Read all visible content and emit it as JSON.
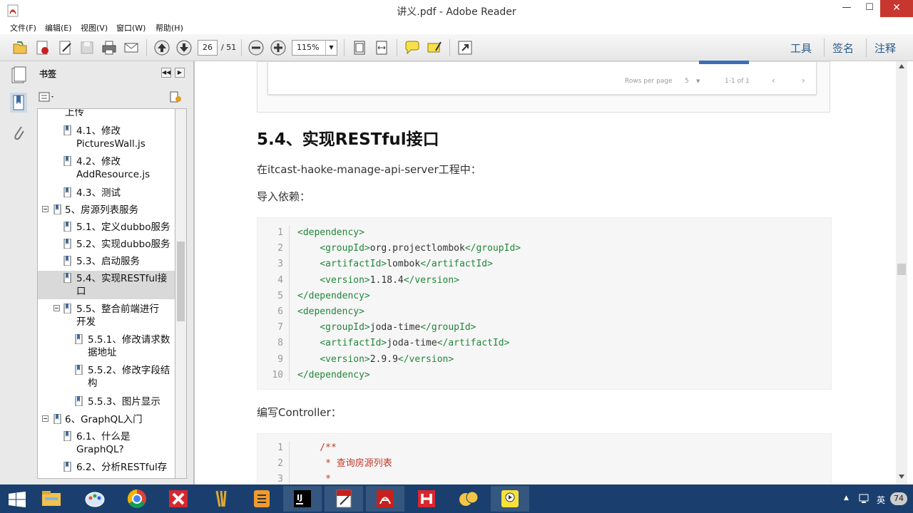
{
  "window": {
    "title": "讲义.pdf - Adobe Reader",
    "min_glyph": "—",
    "max_glyph": "☐",
    "close_glyph": "✕"
  },
  "menu": [
    "文件(F)",
    "编辑(E)",
    "视图(V)",
    "窗口(W)",
    "帮助(H)"
  ],
  "toolbar": {
    "page_current": "26",
    "page_total": "/ 51",
    "zoom": "115%",
    "zoom_arrow": "▼",
    "right_links": [
      "工具",
      "签名",
      "注释"
    ]
  },
  "bookmarks": {
    "header": "书签",
    "collapse_glyph": "◀◀",
    "close_glyph": "▶",
    "items": [
      {
        "label": "上传"
      },
      {
        "label": "4.1、修改\nPicturesWall.js"
      },
      {
        "label": "4.2、修改\nAddResource.js"
      },
      {
        "label": "4.3、测试"
      },
      {
        "label": "5、房源列表服务"
      },
      {
        "label": "5.1、定义dubbo服务"
      },
      {
        "label": "5.2、实现dubbo服务"
      },
      {
        "label": "5.3、启动服务"
      },
      {
        "label": "5.4、实现RESTful接\n口"
      },
      {
        "label": "5.5、整合前端进行\n开发"
      },
      {
        "label": "5.5.1、修改请求数\n据地址"
      },
      {
        "label": "5.5.2、修改字段结\n构"
      },
      {
        "label": "5.5.3、图片显示"
      },
      {
        "label": "6、GraphQL入门"
      },
      {
        "label": "6.1、什么是\nGraphQL?"
      },
      {
        "label": "6.2、分析RESTful存"
      }
    ]
  },
  "document": {
    "pagination": {
      "rows_per_page": "Rows per page",
      "rows_value": "5",
      "range": "1-1 of 1",
      "prev": "‹",
      "next": "›"
    },
    "heading": "5.4、实现RESTful接口",
    "para1": "在itcast-haoke-manage-api-server工程中：",
    "para2": "导入依赖：",
    "para3": "编写Controller：",
    "code1": [
      {
        "n": "1",
        "pre": "",
        "tag": "<dependency>",
        "text": "",
        "close": ""
      },
      {
        "n": "2",
        "pre": "    ",
        "tag": "<groupId>",
        "text": "org.projectlombok",
        "close": "</groupId>"
      },
      {
        "n": "3",
        "pre": "    ",
        "tag": "<artifactId>",
        "text": "lombok",
        "close": "</artifactId>"
      },
      {
        "n": "4",
        "pre": "    ",
        "tag": "<version>",
        "text": "1.18.4",
        "close": "</version>"
      },
      {
        "n": "5",
        "pre": "",
        "tag": "</dependency>",
        "text": "",
        "close": ""
      },
      {
        "n": "6",
        "pre": "",
        "tag": "<dependency>",
        "text": "",
        "close": ""
      },
      {
        "n": "7",
        "pre": "    ",
        "tag": "<groupId>",
        "text": "joda-time",
        "close": "</groupId>"
      },
      {
        "n": "8",
        "pre": "    ",
        "tag": "<artifactId>",
        "text": "joda-time",
        "close": "</artifactId>"
      },
      {
        "n": "9",
        "pre": "    ",
        "tag": "<version>",
        "text": "2.9.9",
        "close": "</version>"
      },
      {
        "n": "10",
        "pre": "",
        "tag": "</dependency>",
        "text": "",
        "close": ""
      }
    ],
    "code2": [
      {
        "n": "1",
        "text": "    /**"
      },
      {
        "n": "2",
        "text": "     * 查询房源列表"
      },
      {
        "n": "3",
        "text": "     *"
      }
    ]
  },
  "taskbar": {
    "tray_ime": "英",
    "tray_clock": "74",
    "tray_up": "▲"
  }
}
